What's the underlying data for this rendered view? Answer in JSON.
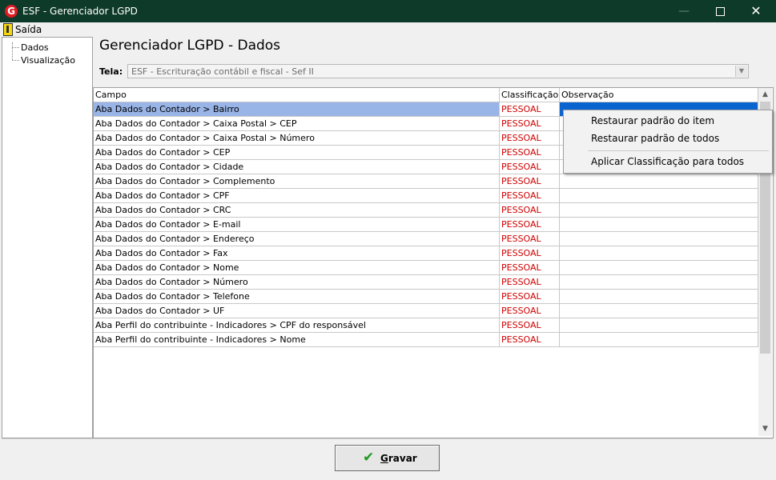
{
  "window": {
    "title": "ESF - Gerenciador LGPD",
    "icon": "G",
    "controls": {
      "minimize": "—",
      "maximize": "",
      "close": "✕"
    }
  },
  "menu": {
    "exit_label": "Saída"
  },
  "tree": {
    "items": [
      "Dados",
      "Visualização"
    ]
  },
  "page": {
    "heading": "Gerenciador LGPD - Dados"
  },
  "screen_select": {
    "label": "Tela:",
    "value": "ESF - Escrituração contábil e fiscal - Sef II"
  },
  "table": {
    "columns": [
      "Campo",
      "Classificação",
      "Observação"
    ],
    "rows": [
      {
        "campo": "Aba Dados do Contador > Bairro",
        "classificacao": "PESSOAL",
        "observacao": ""
      },
      {
        "campo": "Aba Dados do Contador > Caixa Postal > CEP",
        "classificacao": "PESSOAL",
        "observacao": ""
      },
      {
        "campo": "Aba Dados do Contador > Caixa Postal > Número",
        "classificacao": "PESSOAL",
        "observacao": ""
      },
      {
        "campo": "Aba Dados do Contador > CEP",
        "classificacao": "PESSOAL",
        "observacao": ""
      },
      {
        "campo": "Aba Dados do Contador > Cidade",
        "classificacao": "PESSOAL",
        "observacao": ""
      },
      {
        "campo": "Aba Dados do Contador > Complemento",
        "classificacao": "PESSOAL",
        "observacao": ""
      },
      {
        "campo": "Aba Dados do Contador > CPF",
        "classificacao": "PESSOAL",
        "observacao": ""
      },
      {
        "campo": "Aba Dados do Contador > CRC",
        "classificacao": "PESSOAL",
        "observacao": ""
      },
      {
        "campo": "Aba Dados do Contador > E-mail",
        "classificacao": "PESSOAL",
        "observacao": ""
      },
      {
        "campo": "Aba Dados do Contador > Endereço",
        "classificacao": "PESSOAL",
        "observacao": ""
      },
      {
        "campo": "Aba Dados do Contador > Fax",
        "classificacao": "PESSOAL",
        "observacao": ""
      },
      {
        "campo": "Aba Dados do Contador > Nome",
        "classificacao": "PESSOAL",
        "observacao": ""
      },
      {
        "campo": "Aba Dados do Contador > Número",
        "classificacao": "PESSOAL",
        "observacao": ""
      },
      {
        "campo": "Aba Dados do Contador > Telefone",
        "classificacao": "PESSOAL",
        "observacao": ""
      },
      {
        "campo": "Aba Dados do Contador > UF",
        "classificacao": "PESSOAL",
        "observacao": ""
      },
      {
        "campo": "Aba Perfil do contribuinte - Indicadores > CPF do responsável",
        "classificacao": "PESSOAL",
        "observacao": ""
      },
      {
        "campo": "Aba Perfil do contribuinte - Indicadores > Nome",
        "classificacao": "PESSOAL",
        "observacao": ""
      }
    ]
  },
  "context_menu": {
    "items": [
      "Restaurar padrão do item",
      "Restaurar padrão de todos",
      "Aplicar Classificação para todos"
    ]
  },
  "save_button": {
    "label": "Gravar",
    "icon": "check-icon"
  },
  "colors": {
    "titlebar": "#0e3a2a",
    "classification_text": "#d00000",
    "selected_row": "#99b4e6",
    "selected_cell": "#0a64d0",
    "save_icon": "#1c9a1c"
  }
}
